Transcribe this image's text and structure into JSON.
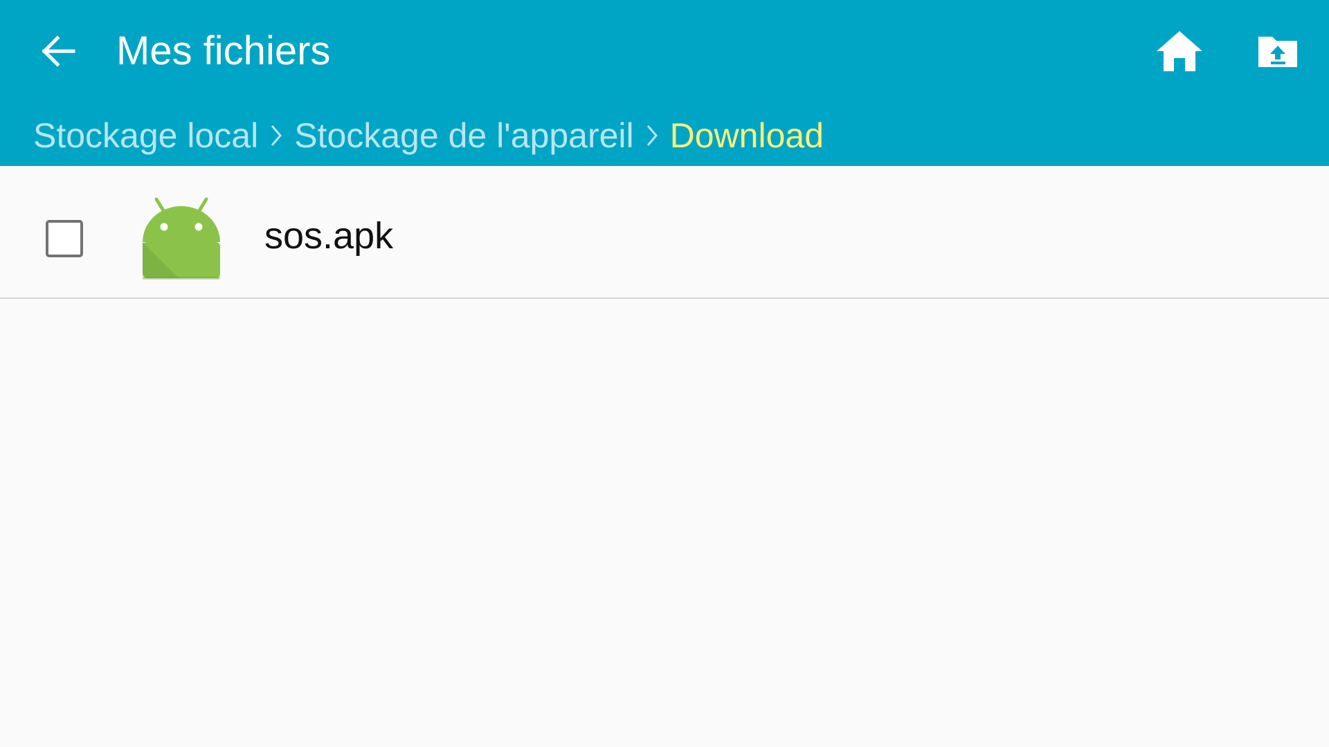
{
  "header": {
    "title": "Mes fichiers",
    "back_icon": "arrow-left-icon",
    "actions": [
      {
        "name": "home",
        "icon": "home-icon"
      },
      {
        "name": "upload",
        "icon": "folder-upload-icon"
      }
    ]
  },
  "breadcrumb": {
    "items": [
      {
        "label": "Stockage local"
      },
      {
        "label": "Stockage de l'appareil"
      },
      {
        "label": "Download"
      }
    ],
    "separator_icon": "chevron-right-icon"
  },
  "files": [
    {
      "name": "sos.apk",
      "icon": "android-apk-icon",
      "checked": false
    }
  ],
  "colors": {
    "header_bg": "#00a5c5",
    "crumb": "#b8e6f1",
    "crumb_current": "#fff07a",
    "android_green": "#8bc34a",
    "list_bg": "#fafafa"
  }
}
